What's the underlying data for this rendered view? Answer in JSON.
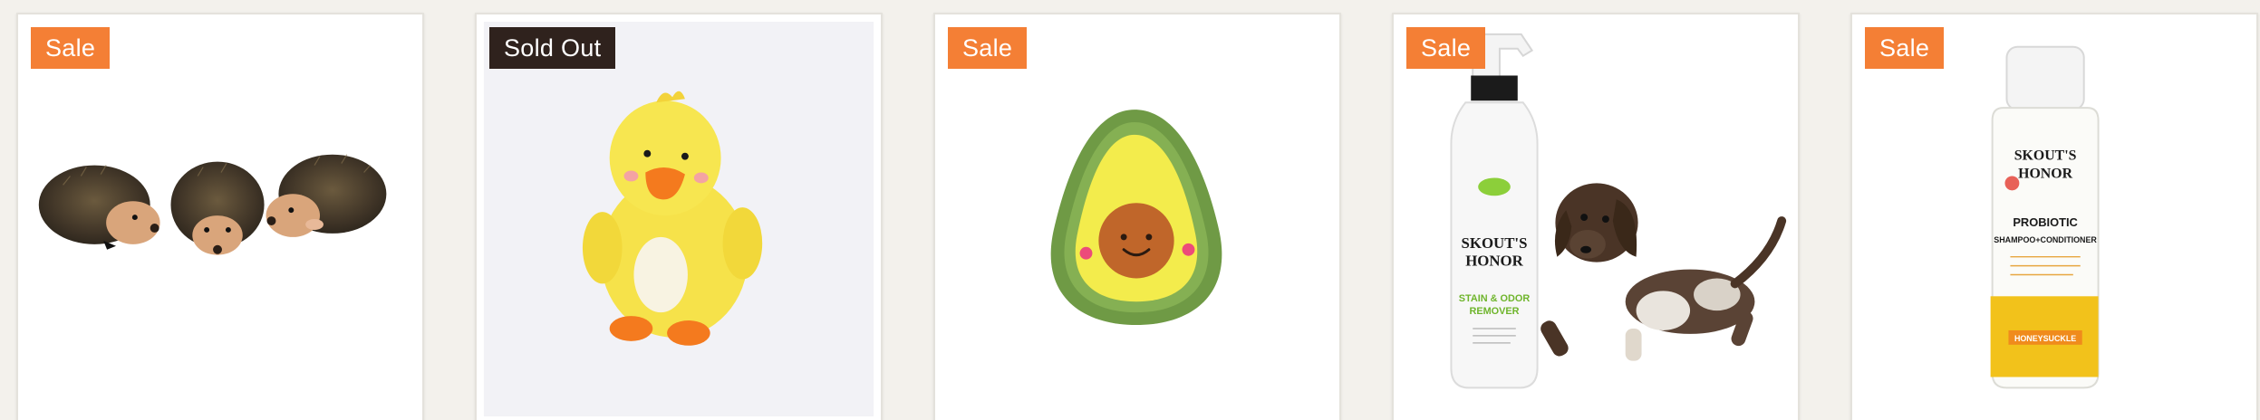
{
  "products": [
    {
      "badge": "Sale",
      "image": "hedgehog-plush-toys-icon"
    },
    {
      "badge": "Sold Out",
      "image": "yellow-duck-plush-icon"
    },
    {
      "badge": "Sale",
      "image": "avocado-plush-toy-icon"
    },
    {
      "badge": "Sale",
      "image": "stain-odor-remover-and-puppy-icon",
      "label": {
        "brand_line1": "SKOUT'S",
        "brand_line2": "HONOR",
        "product_line1": "STAIN & ODOR",
        "product_line2": "REMOVER"
      }
    },
    {
      "badge": "Sale",
      "image": "probiotic-shampoo-bottle-icon",
      "label": {
        "brand_line1": "SKOUT'S",
        "brand_line2": "HONOR",
        "product_line1": "PROBIOTIC",
        "product_line2": "SHAMPOO+CONDITIONER",
        "scent": "HONEYSUCKLE"
      }
    }
  ],
  "colors": {
    "sale": "#f47f35",
    "sold_out": "#2f221d",
    "background": "#f3f1ec"
  }
}
